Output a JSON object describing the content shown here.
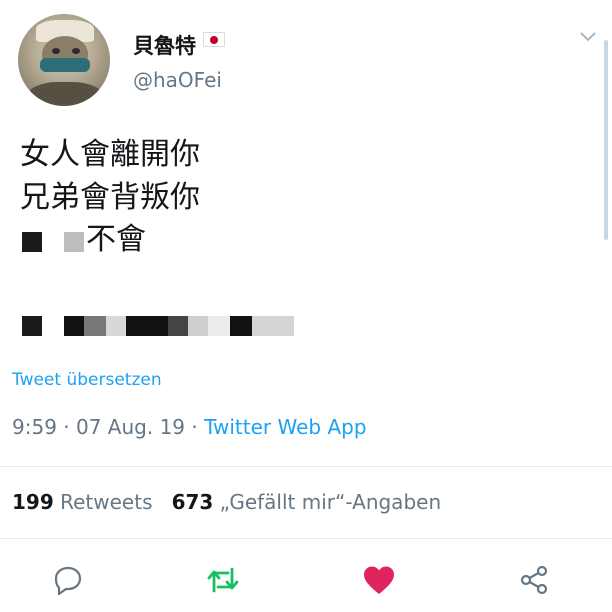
{
  "user": {
    "display_name": "貝魯特",
    "handle": "@haOFei"
  },
  "tweet": {
    "lines": [
      "女人會離開你",
      "兄弟會背叛你",
      "不會"
    ],
    "translate_label": "Tweet übersetzen",
    "time": "9:59",
    "date": "07 Aug. 19",
    "separator": " · ",
    "source": "Twitter Web App"
  },
  "stats": {
    "retweets_count": "199",
    "retweets_label": "Retweets",
    "likes_count": "673",
    "likes_label": "„Gefällt mir“-Angaben"
  },
  "icons": {
    "reply": "reply-icon",
    "retweet": "retweet-icon",
    "like": "heart-icon",
    "share": "share-icon",
    "menu": "chevron-down-icon"
  },
  "colors": {
    "link": "#1da1f2",
    "retweet": "#17bf63",
    "like": "#e0245e",
    "muted": "#657786"
  }
}
